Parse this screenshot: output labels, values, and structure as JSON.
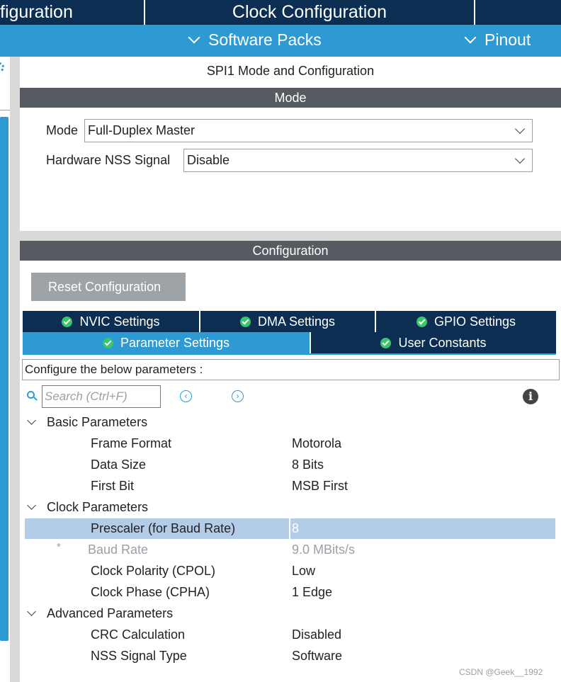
{
  "top_tabs": {
    "pinout_config_partial": "figuration",
    "clock_config": "Clock Configuration"
  },
  "subbar": {
    "software_packs": "Software Packs",
    "pinout": "Pinout"
  },
  "panel": {
    "title": "SPI1 Mode and Configuration",
    "mode_header": "Mode",
    "mode_label": "Mode",
    "mode_value": "Full-Duplex Master",
    "nss_label": "Hardware NSS Signal",
    "nss_value": "Disable",
    "config_header": "Configuration",
    "reset_button": "Reset Configuration"
  },
  "param_tabs": {
    "nvic": "NVIC Settings",
    "dma": "DMA Settings",
    "gpio": "GPIO Settings",
    "parameter": "Parameter Settings",
    "user_constants": "User Constants"
  },
  "description": "Configure the below parameters :",
  "search_placeholder": "Search (Ctrl+F)",
  "groups": {
    "basic": {
      "title": "Basic Parameters",
      "rows": [
        {
          "name": "Frame Format",
          "value": "Motorola"
        },
        {
          "name": "Data Size",
          "value": "8 Bits"
        },
        {
          "name": "First Bit",
          "value": "MSB First"
        }
      ]
    },
    "clock": {
      "title": "Clock Parameters",
      "rows": [
        {
          "name": "Prescaler (for Baud Rate)",
          "value": "8"
        },
        {
          "marker": "*",
          "name": "Baud Rate",
          "value": "9.0 MBits/s"
        },
        {
          "name": "Clock Polarity (CPOL)",
          "value": "Low"
        },
        {
          "name": "Clock Phase (CPHA)",
          "value": "1 Edge"
        }
      ]
    },
    "advanced": {
      "title": "Advanced Parameters",
      "rows": [
        {
          "name": "CRC Calculation",
          "value": "Disabled"
        },
        {
          "name": "NSS Signal Type",
          "value": "Software"
        }
      ]
    }
  },
  "watermark": "CSDN @Geek__1992",
  "colors": {
    "navy": "#0b2e52",
    "blue": "#2e9ad4",
    "section_bar": "#555b61",
    "highlight": "#b3cde8",
    "check_green": "#39c66d"
  }
}
